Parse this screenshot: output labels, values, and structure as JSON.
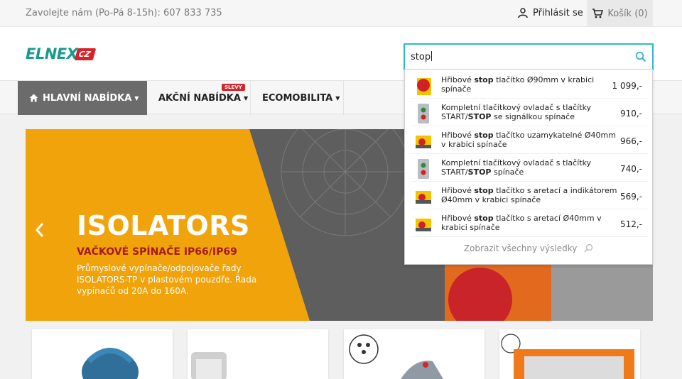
{
  "topbar": {
    "contact": "Zavolejte nám (Po-Pá 8-15h): 607 833 735",
    "login": "Přihlásit se",
    "cart": "Košík (0)"
  },
  "logo": {
    "name": "ELNEX",
    "suffix": "CZ"
  },
  "search": {
    "value": "stop"
  },
  "nav": {
    "items": [
      {
        "label": "HLAVNÍ NABÍDKA"
      },
      {
        "label": "AKČNÍ NABÍDKA",
        "badge": "SLEVY"
      },
      {
        "label": "ECOMOBILITA"
      }
    ]
  },
  "hero": {
    "title": "ISOLATORS",
    "subtitle": "VAČKOVÉ SPÍNAČE IP66/IP69",
    "text": "Průmyslové vypínače/odpojovače řady ISOLATORS-TP v plastovém pouzdře. Řada vypínačů od 20A do 160A."
  },
  "results": [
    {
      "before": "Hřibové ",
      "bold": "stop",
      "after": " tlačítko Ø90mm v krabici spínače",
      "price": "1 099,-",
      "thumb": "red-mushroom-icon"
    },
    {
      "before": "Kompletní tlačítkový ovladač s tlačítky START/",
      "bold": "STOP",
      "after": " se signálkou spínače",
      "price": "910,-",
      "thumb": "grey-control-box-icon"
    },
    {
      "before": "Hřibové ",
      "bold": "stop",
      "after": " tlačítko uzamykatelné Ø40mm v krabici spínače",
      "price": "966,-",
      "thumb": "yellow-box-icon"
    },
    {
      "before": "Kompletní tlačítkový ovladač s tlačítky START/",
      "bold": "STOP",
      "after": " spínače",
      "price": "740,-",
      "thumb": "grey-control-box-icon"
    },
    {
      "before": "Hřibové ",
      "bold": "stop",
      "after": " tlačítko s aretací a indikátorem Ø40mm v krabici spínače",
      "price": "569,-",
      "thumb": "yellow-box-icon"
    },
    {
      "before": "Hřibové ",
      "bold": "stop",
      "after": " tlačítko s aretací Ø40mm v krabici spínače",
      "price": "512,-",
      "thumb": "yellow-box-icon"
    }
  ],
  "show_all": "Zobrazit všechny výsledky",
  "colors": {
    "accent": "#2fb5d2",
    "hero_orange": "#f0a30a",
    "brand_red": "#d8232a",
    "brand_teal": "#1a9a8e"
  }
}
